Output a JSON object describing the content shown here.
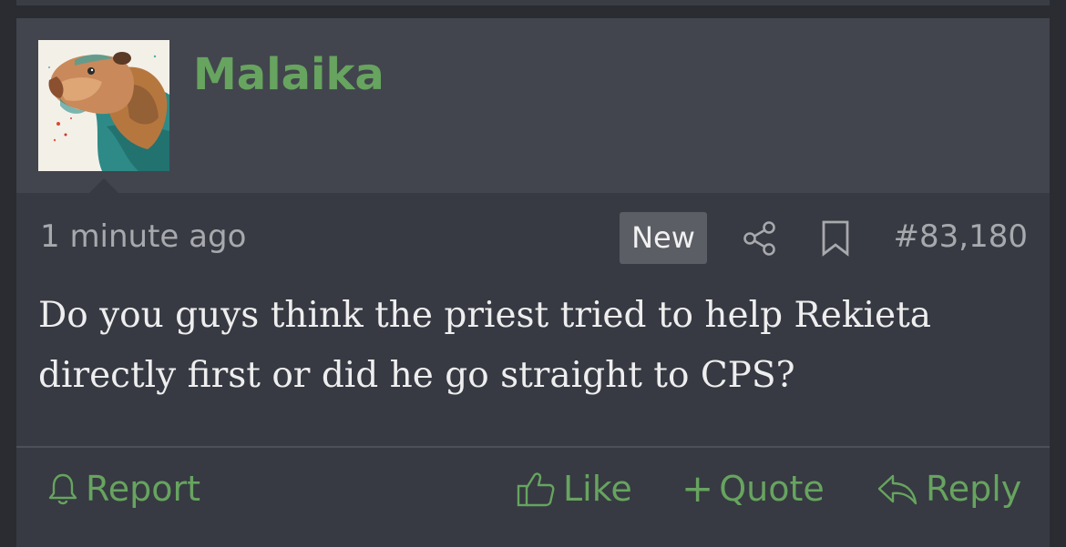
{
  "post": {
    "username": "Malaika",
    "avatar_alt": "",
    "time": "1 minute ago",
    "badge": "New",
    "post_number": "#83,180",
    "message": "Do you guys think the priest tried to help Rekieta directly first or did he go straight to CPS?",
    "icons": {
      "share": "share-icon",
      "bookmark": "bookmark-icon"
    }
  },
  "actions": {
    "report": "Report",
    "like": "Like",
    "quote": "Quote",
    "reply": "Reply"
  },
  "colors": {
    "accent": "#67a45f",
    "header_bg": "#42454d",
    "post_bg": "#373a42",
    "page_bg": "#2a2c32",
    "meta_text": "#a7a9ad",
    "body_text": "#eeeeef"
  }
}
